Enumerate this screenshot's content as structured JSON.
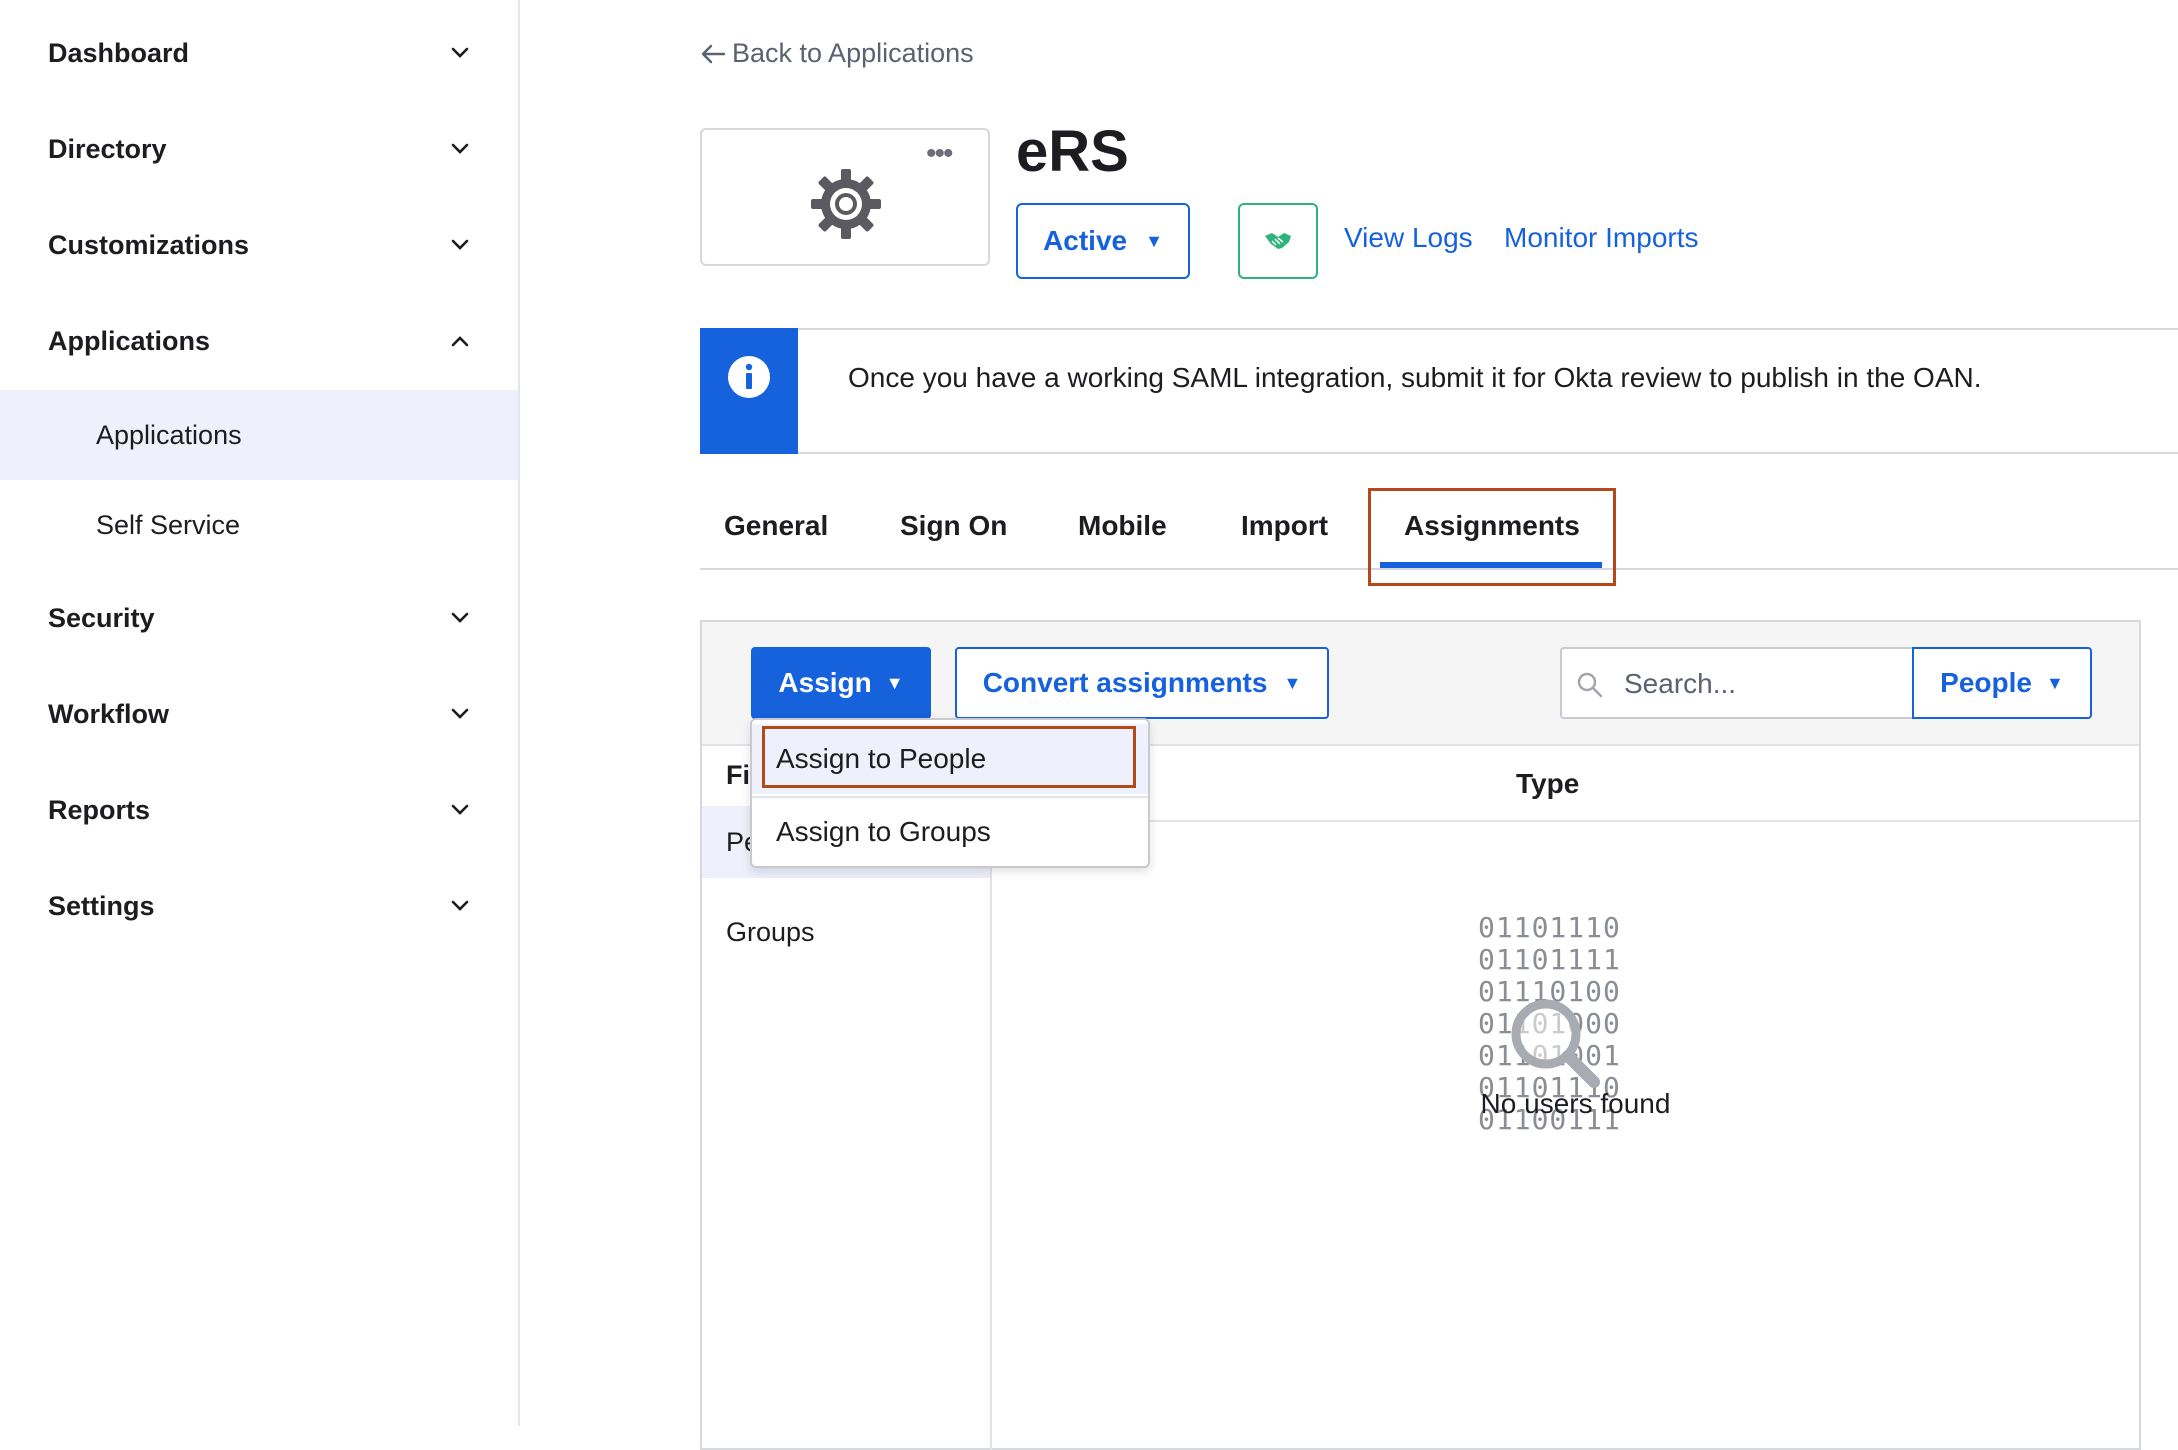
{
  "sidebar": {
    "sections": [
      {
        "label": "Dashboard",
        "expanded": false
      },
      {
        "label": "Directory",
        "expanded": false
      },
      {
        "label": "Customizations",
        "expanded": false
      },
      {
        "label": "Applications",
        "expanded": true
      },
      {
        "label": "Security",
        "expanded": false
      },
      {
        "label": "Workflow",
        "expanded": false
      },
      {
        "label": "Reports",
        "expanded": false
      },
      {
        "label": "Settings",
        "expanded": false
      }
    ],
    "applications_sub": [
      {
        "label": "Applications",
        "active": true
      },
      {
        "label": "Self Service",
        "active": false
      }
    ]
  },
  "header": {
    "back_link": "Back to Applications",
    "app_name": "eRS",
    "status": "Active",
    "view_logs": "View Logs",
    "monitor_imports": "Monitor Imports",
    "more_icon": "more-dots-icon",
    "app_icon": "gear-icon"
  },
  "banner": {
    "message": "Once you have a working SAML integration, submit it for Okta review to publish in the OAN."
  },
  "tabs": [
    {
      "label": "General"
    },
    {
      "label": "Sign On"
    },
    {
      "label": "Mobile"
    },
    {
      "label": "Import"
    },
    {
      "label": "Assignments",
      "active": true
    }
  ],
  "toolbar": {
    "assign": "Assign",
    "convert": "Convert assignments",
    "search_placeholder": "Search...",
    "people": "People"
  },
  "dropdown": {
    "items": [
      "Assign to People",
      "Assign to Groups"
    ]
  },
  "filters": {
    "title": "Fi",
    "items": [
      "Pe",
      "Groups"
    ]
  },
  "table": {
    "type_header": "Type",
    "binary": [
      "01101110",
      "01101111",
      "01110100",
      "01101000",
      "01101001",
      "01101110",
      "01100111"
    ],
    "empty_message": "No users found"
  },
  "colors": {
    "primary": "#1662dd",
    "highlight_border": "#b5481b",
    "active_bg": "#eef0fb",
    "success": "#2fb37c"
  }
}
